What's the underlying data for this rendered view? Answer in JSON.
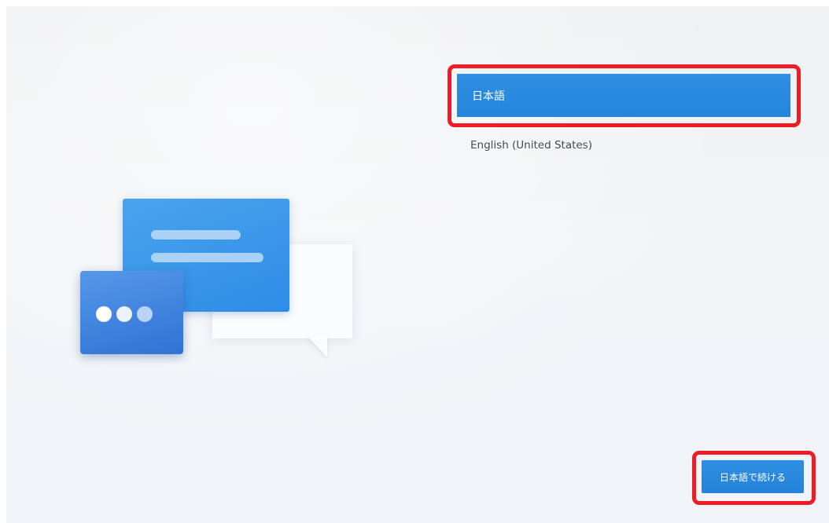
{
  "languages": {
    "selected": "日本語",
    "other": "English (United States)"
  },
  "continue_button": {
    "label": "日本語で続ける"
  },
  "illustration": {
    "icon": "chat-bubbles-illustration",
    "accent_color": "#2d8ce6",
    "secondary_color": "#2f73d6"
  },
  "highlight": {
    "color": "#ee1c24"
  }
}
